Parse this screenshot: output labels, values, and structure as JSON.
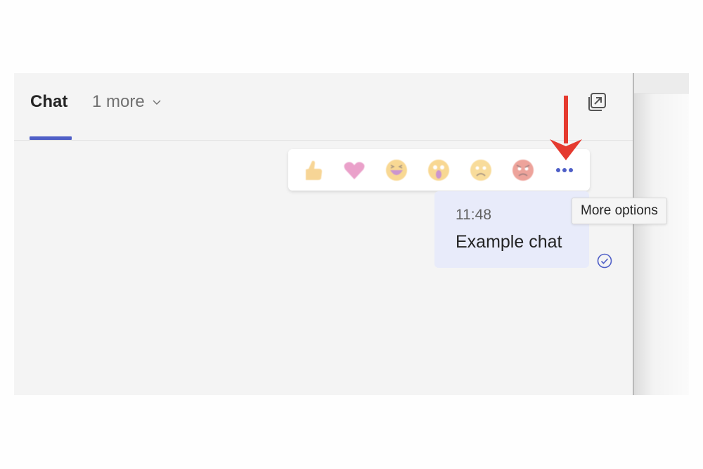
{
  "tabs": {
    "active_label": "Chat",
    "more_label": "1 more"
  },
  "icons": {
    "popout": "pop-out-icon",
    "chevron": "chevron-down-icon",
    "read_receipt": "check-circle-icon"
  },
  "reactions": [
    {
      "name": "like",
      "icon": "thumbs-up-icon"
    },
    {
      "name": "heart",
      "icon": "heart-icon"
    },
    {
      "name": "laugh",
      "icon": "laughing-face-icon"
    },
    {
      "name": "surprised",
      "icon": "surprised-face-icon"
    },
    {
      "name": "sad",
      "icon": "sad-face-icon"
    },
    {
      "name": "angry",
      "icon": "angry-face-icon"
    }
  ],
  "message": {
    "time": "11:48",
    "text": "Example chat"
  },
  "tooltip": {
    "text": "More options"
  },
  "colors": {
    "accent": "#4f5fc7",
    "bubble": "#e8ebfa",
    "annotation_arrow": "#e53a2f"
  }
}
